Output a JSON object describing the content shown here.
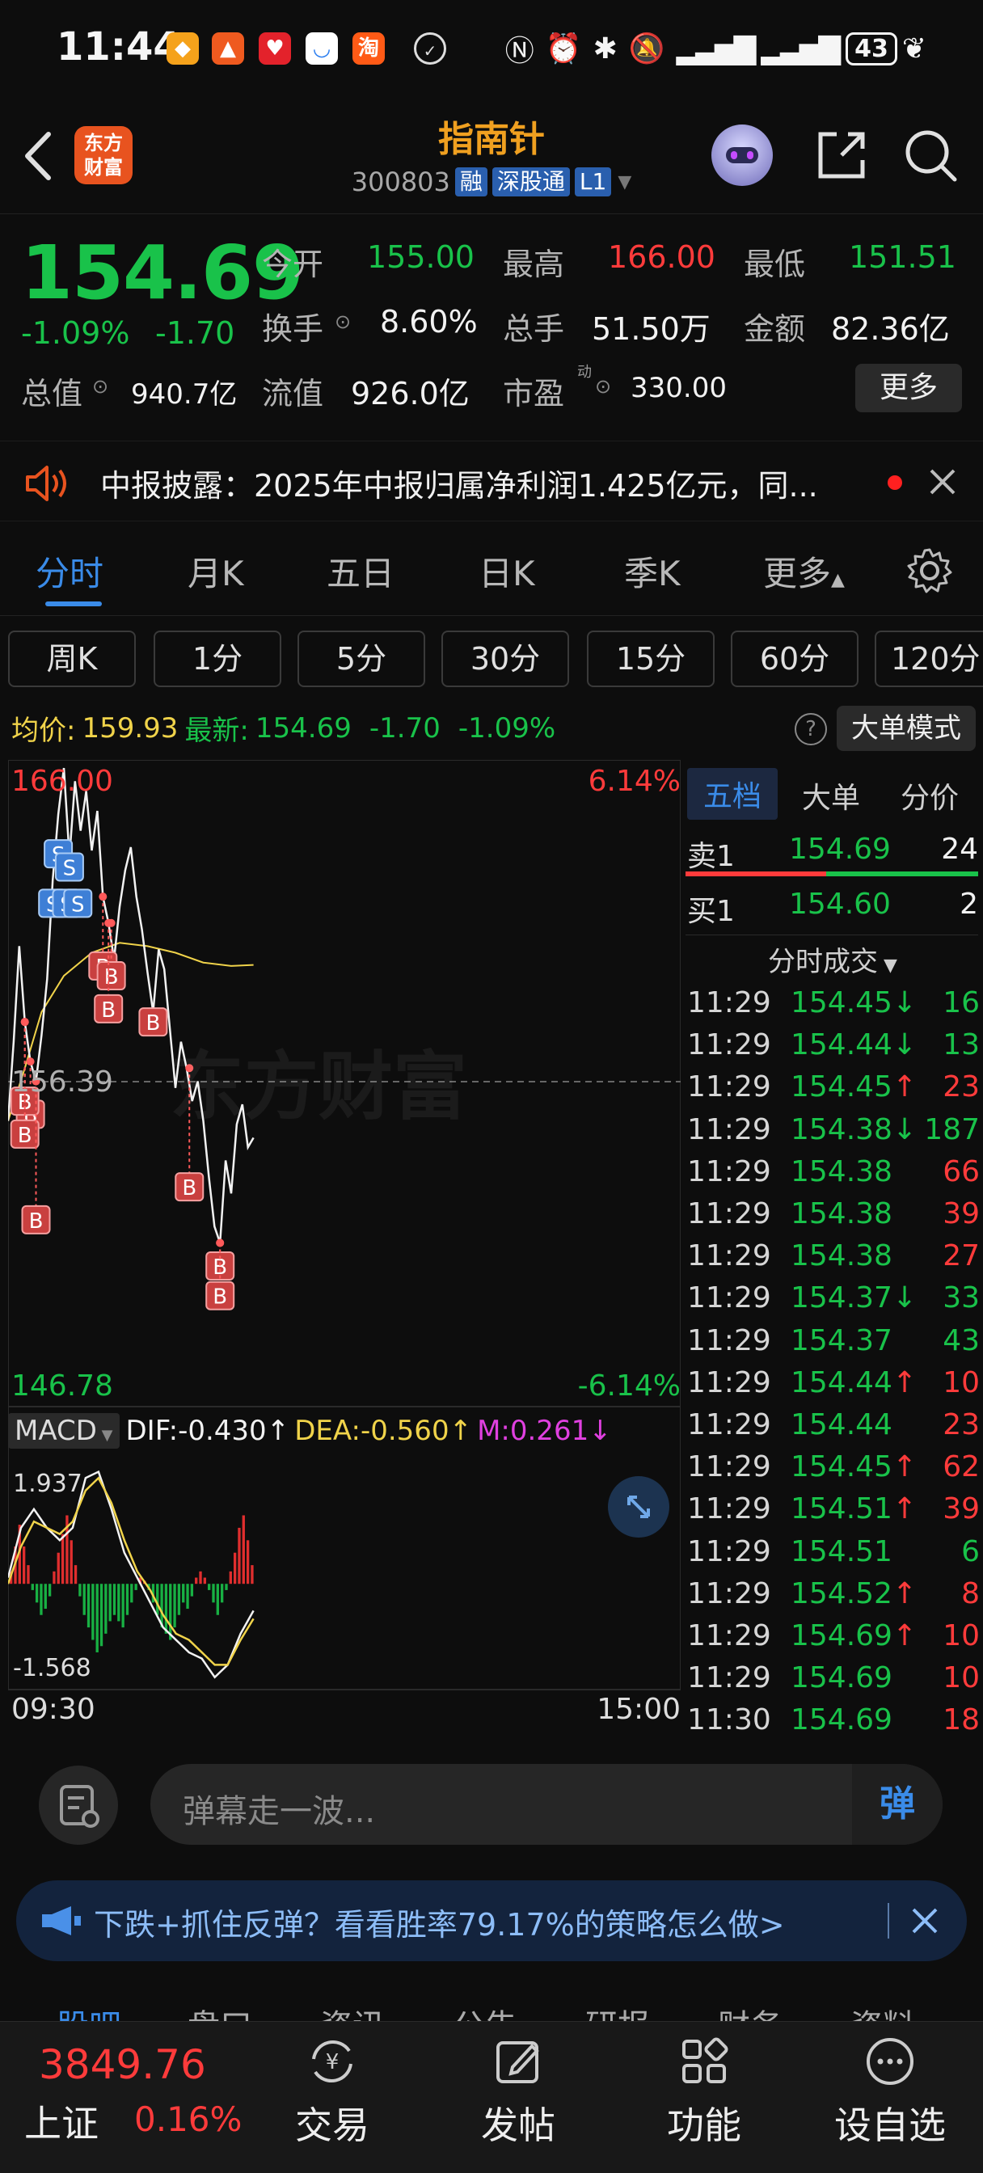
{
  "status_bar": {
    "time": "11:44",
    "battery": "43"
  },
  "header": {
    "back_icon": "chevron-left-icon",
    "logo_text": [
      "东方",
      "财富"
    ],
    "stock_name": "指南针",
    "stock_code": "300803",
    "tags": [
      "融",
      "深股通",
      "L1"
    ]
  },
  "quote": {
    "price": "154.69",
    "change_pct": "-1.09%",
    "change": "-1.70",
    "fields": [
      {
        "label": "今开",
        "value": "155.00"
      },
      {
        "label": "最高",
        "value": "166.00"
      },
      {
        "label": "最低",
        "value": "151.51"
      },
      {
        "label": "换手",
        "value": "8.60%"
      },
      {
        "label": "总手",
        "value": "51.50万"
      },
      {
        "label": "金额",
        "value": "82.36亿"
      },
      {
        "label": "总值",
        "value": "940.7亿"
      },
      {
        "label": "流值",
        "value": "926.0亿"
      },
      {
        "label": "市盈",
        "value": "330.00"
      }
    ],
    "pe_superscript": "动",
    "more_label": "更多"
  },
  "notice": {
    "text": "中报披露：2025年中报归属净利润1.425亿元，同..."
  },
  "tabs": {
    "main": [
      "分时",
      "月K",
      "五日",
      "日K",
      "季K",
      "更多"
    ],
    "periods": [
      "周K",
      "1分",
      "5分",
      "30分",
      "15分",
      "60分",
      "120分"
    ]
  },
  "info_row": {
    "avg_label": "均价:",
    "avg_value": "159.93",
    "latest_label": "最新:",
    "latest_value": "154.69",
    "latest_change": "-1.70",
    "latest_pct": "-1.09%",
    "help": "?",
    "big_order_mode": "大单模式"
  },
  "chart_labels": {
    "high": "166.00",
    "low": "146.78",
    "high_pct": "6.14%",
    "low_pct": "-6.14%",
    "prev_close": "156.39",
    "watermark": "东方财富",
    "macd_label": "MACD",
    "dif": "DIF:-0.430",
    "dea": "DEA:-0.560",
    "m": "M:0.261",
    "macd_max": "1.937",
    "macd_min": "-1.568",
    "time_start": "09:30",
    "time_end": "15:00",
    "buy_marker": "B",
    "sell_marker": "S"
  },
  "chart_data": {
    "type": "line",
    "title": "",
    "x_range": [
      "09:30",
      "15:00"
    ],
    "y_range": [
      146.78,
      166.0
    ],
    "prev_close": 156.39,
    "price_series": [
      [
        0,
        155.2
      ],
      [
        2,
        157.6
      ],
      [
        4,
        160.5
      ],
      [
        6,
        158.2
      ],
      [
        8,
        157.0
      ],
      [
        10,
        156.4
      ],
      [
        12,
        157.8
      ],
      [
        14,
        159.5
      ],
      [
        16,
        162.5
      ],
      [
        18,
        164.5
      ],
      [
        20,
        165.9
      ],
      [
        22,
        163.2
      ],
      [
        24,
        165.5
      ],
      [
        26,
        164.0
      ],
      [
        28,
        165.2
      ],
      [
        30,
        163.4
      ],
      [
        32,
        164.6
      ],
      [
        34,
        162.0
      ],
      [
        36,
        161.2
      ],
      [
        38,
        160.1
      ],
      [
        40,
        161.7
      ],
      [
        42,
        162.8
      ],
      [
        44,
        163.5
      ],
      [
        46,
        162.0
      ],
      [
        48,
        161.0
      ],
      [
        50,
        159.7
      ],
      [
        52,
        158.5
      ],
      [
        54,
        160.4
      ],
      [
        56,
        159.8
      ],
      [
        58,
        158.0
      ],
      [
        60,
        156.2
      ],
      [
        62,
        157.6
      ],
      [
        64,
        156.8
      ],
      [
        66,
        155.8
      ],
      [
        68,
        156.4
      ],
      [
        70,
        155.2
      ],
      [
        72,
        153.5
      ],
      [
        74,
        152.0
      ],
      [
        76,
        151.5
      ],
      [
        78,
        154.0
      ],
      [
        80,
        153.0
      ],
      [
        82,
        155.1
      ],
      [
        84,
        155.7
      ],
      [
        86,
        154.4
      ],
      [
        88,
        154.69
      ]
    ],
    "avg_series": [
      [
        0,
        155.2
      ],
      [
        6,
        156.8
      ],
      [
        12,
        158.5
      ],
      [
        20,
        159.6
      ],
      [
        30,
        160.3
      ],
      [
        40,
        160.6
      ],
      [
        50,
        160.5
      ],
      [
        60,
        160.3
      ],
      [
        70,
        160.0
      ],
      [
        80,
        159.9
      ],
      [
        88,
        159.93
      ]
    ],
    "total_minutes": 240,
    "trade_markers": [
      {
        "type": "S",
        "t": 18,
        "price": 163.3
      },
      {
        "type": "S",
        "t": 22,
        "price": 162.9
      },
      {
        "type": "S",
        "t": 16,
        "price": 161.8
      },
      {
        "type": "S",
        "t": 21,
        "price": 161.8
      },
      {
        "type": "S",
        "t": 25,
        "price": 161.8
      },
      {
        "type": "B",
        "t": 8,
        "price": 155.4
      },
      {
        "type": "B",
        "t": 6,
        "price": 155.8
      },
      {
        "type": "B",
        "t": 6,
        "price": 154.8
      },
      {
        "type": "B",
        "t": 10,
        "price": 152.2
      },
      {
        "type": "B",
        "t": 34,
        "price": 159.9
      },
      {
        "type": "B",
        "t": 37,
        "price": 159.6
      },
      {
        "type": "B",
        "t": 36,
        "price": 158.6
      },
      {
        "type": "B",
        "t": 52,
        "price": 158.2
      },
      {
        "type": "B",
        "t": 65,
        "price": 153.2
      },
      {
        "type": "B",
        "t": 76,
        "price": 150.8
      },
      {
        "type": "B",
        "t": 76,
        "price": 149.9
      }
    ],
    "macd": {
      "y_range": [
        -1.568,
        1.937
      ],
      "histogram": [
        0.2,
        0.6,
        0.95,
        0.6,
        0.3,
        -0.1,
        -0.3,
        -0.5,
        -0.4,
        -0.2,
        0.2,
        0.5,
        0.8,
        1.1,
        0.7,
        0.3,
        -0.2,
        -0.5,
        -0.7,
        -0.9,
        -1.1,
        -1.0,
        -0.8,
        -0.6,
        -0.5,
        -0.6,
        -0.7,
        -0.5,
        -0.3,
        -0.1,
        0.1,
        0.05,
        -0.1,
        -0.3,
        -0.5,
        -0.7,
        -0.8,
        -0.9,
        -0.7,
        -0.5,
        -0.3,
        -0.4,
        -0.2,
        0.1,
        0.2,
        0.1,
        -0.1,
        -0.3,
        -0.5,
        -0.3,
        -0.1,
        0.2,
        0.5,
        0.9,
        1.1,
        0.7,
        0.3
      ],
      "dif": [
        0.1,
        0.9,
        1.2,
        0.9,
        0.7,
        0.9,
        1.7,
        1.8,
        1.2,
        0.5,
        0.1,
        -0.3,
        -0.7,
        -0.9,
        -1.1,
        -1.2,
        -1.5,
        -1.3,
        -0.8,
        -0.43
      ],
      "dea": [
        0.0,
        0.6,
        1.0,
        0.9,
        0.8,
        1.0,
        1.5,
        1.7,
        1.3,
        0.7,
        0.2,
        -0.1,
        -0.5,
        -0.8,
        -0.9,
        -1.1,
        -1.3,
        -1.3,
        -0.9,
        -0.56
      ]
    }
  },
  "right_panel": {
    "tabs": [
      "五档",
      "大单",
      "分价"
    ],
    "ask": {
      "label": "卖1",
      "price": "154.69",
      "vol": "24"
    },
    "bid": {
      "label": "买1",
      "price": "154.60",
      "vol": "2"
    },
    "ticks_title": "分时成交",
    "ticks": [
      {
        "time": "11:29",
        "price": "154.45↓",
        "vol": "16",
        "pc": "green",
        "vc": "green"
      },
      {
        "time": "11:29",
        "price": "154.44↓",
        "vol": "13",
        "pc": "green",
        "vc": "green"
      },
      {
        "time": "11:29",
        "price": "154.45↑",
        "vol": "23",
        "pc": "green",
        "vc": "red"
      },
      {
        "time": "11:29",
        "price": "154.38↓",
        "vol": "187",
        "pc": "green",
        "vc": "green"
      },
      {
        "time": "11:29",
        "price": "154.38",
        "vol": "66",
        "pc": "green",
        "vc": "red"
      },
      {
        "time": "11:29",
        "price": "154.38",
        "vol": "39",
        "pc": "green",
        "vc": "red"
      },
      {
        "time": "11:29",
        "price": "154.38",
        "vol": "27",
        "pc": "green",
        "vc": "red"
      },
      {
        "time": "11:29",
        "price": "154.37↓",
        "vol": "33",
        "pc": "green",
        "vc": "green"
      },
      {
        "time": "11:29",
        "price": "154.37",
        "vol": "43",
        "pc": "green",
        "vc": "green"
      },
      {
        "time": "11:29",
        "price": "154.44↑",
        "vol": "10",
        "pc": "green",
        "vc": "red"
      },
      {
        "time": "11:29",
        "price": "154.44",
        "vol": "23",
        "pc": "green",
        "vc": "red"
      },
      {
        "time": "11:29",
        "price": "154.45↑",
        "vol": "62",
        "pc": "green",
        "vc": "red"
      },
      {
        "time": "11:29",
        "price": "154.51↑",
        "vol": "39",
        "pc": "green",
        "vc": "red"
      },
      {
        "time": "11:29",
        "price": "154.51",
        "vol": "6",
        "pc": "green",
        "vc": "green"
      },
      {
        "time": "11:29",
        "price": "154.52↑",
        "vol": "8",
        "pc": "green",
        "vc": "red"
      },
      {
        "time": "11:29",
        "price": "154.69↑",
        "vol": "10",
        "pc": "green",
        "vc": "red"
      },
      {
        "time": "11:29",
        "price": "154.69",
        "vol": "10",
        "pc": "green",
        "vc": "red"
      },
      {
        "time": "11:30",
        "price": "154.69",
        "vol": "18",
        "pc": "green",
        "vc": "red"
      }
    ]
  },
  "danmu": {
    "placeholder": "弹幕走一波...",
    "send_label": "弹"
  },
  "ad": {
    "text": "下跌+抓住反弹？看看胜率79.17%的策略怎么做>"
  },
  "sub_nav": [
    "股吧",
    "盘口",
    "资讯",
    "公告",
    "研报",
    "财务",
    "资料"
  ],
  "bottom": {
    "index_value": "3849.76",
    "index_name": "上证",
    "index_pct": "0.16%",
    "nav": [
      {
        "label": "交易",
        "icon": "yen-exchange-icon"
      },
      {
        "label": "发帖",
        "icon": "edit-icon"
      },
      {
        "label": "功能",
        "icon": "apps-grid-icon"
      },
      {
        "label": "设自选",
        "icon": "more-circle-icon"
      }
    ]
  },
  "colors": {
    "up": "#ff3b3b",
    "down": "#19c24a",
    "accent": "#3a8be8",
    "avg_line": "#f0d34a"
  }
}
